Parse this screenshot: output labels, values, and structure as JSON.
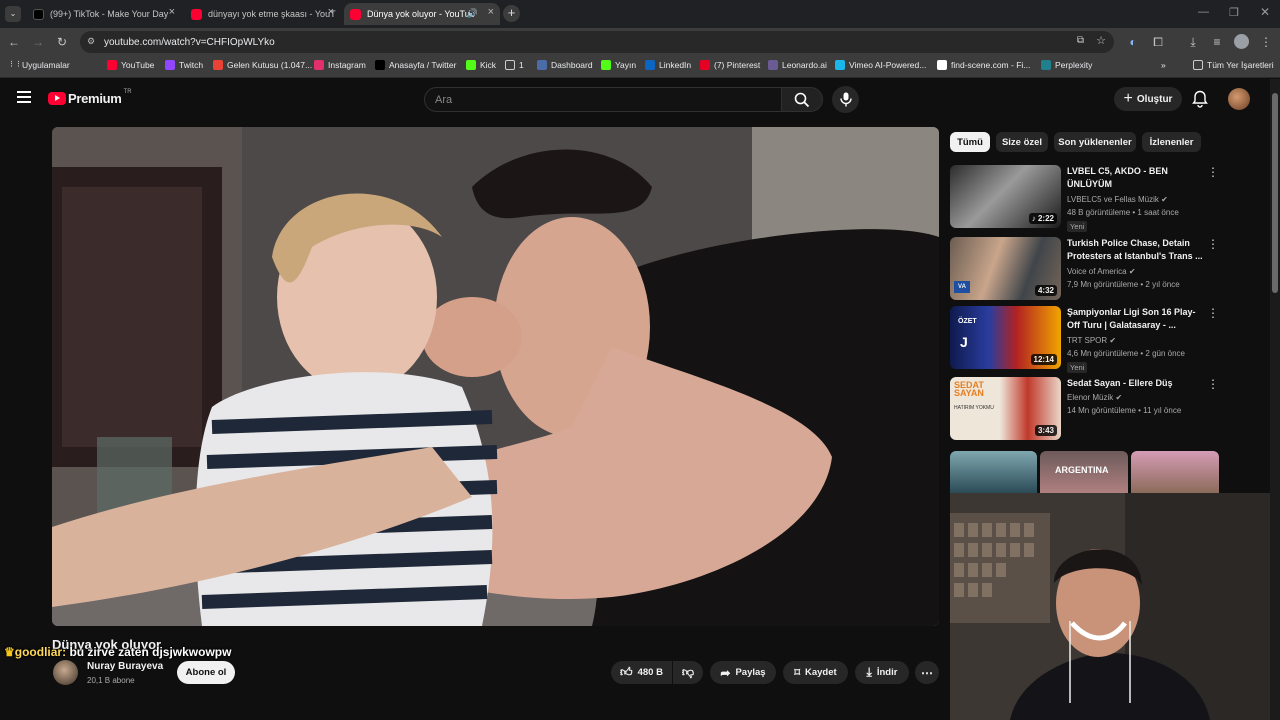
{
  "browser": {
    "tabs": [
      {
        "title": "(99+) TikTok - Make Your Day",
        "fav_color": "#000000"
      },
      {
        "title": "dünyayı yok etme şkaası - YouT",
        "fav_color": "#ff0033"
      },
      {
        "title": "Dünya yok oluyor - YouTub",
        "fav_color": "#ff0033"
      }
    ],
    "url": "youtube.com/watch?v=CHFIOpWLYko",
    "bookmarks": [
      {
        "label": "Uygulamalar",
        "icon": "grid-icon"
      },
      {
        "label": "YouTube",
        "icon": "youtube-icon",
        "color": "#ff0033"
      },
      {
        "label": "Twitch",
        "icon": "twitch-icon",
        "color": "#9146ff"
      },
      {
        "label": "Gelen Kutusu (1.047...",
        "icon": "gmail-icon",
        "color": "#ea4335"
      },
      {
        "label": "Instagram",
        "icon": "instagram-icon",
        "color": "#e1306c"
      },
      {
        "label": "Anasayfa / Twitter",
        "icon": "x-icon",
        "color": "#000000"
      },
      {
        "label": "Kick",
        "icon": "kick-icon",
        "color": "#53fc18"
      },
      {
        "label": "1",
        "icon": "folder-icon"
      },
      {
        "label": "Dashboard",
        "icon": "globe-icon",
        "color": "#4a6da7"
      },
      {
        "label": "Yayın",
        "icon": "kick-icon",
        "color": "#53fc18"
      },
      {
        "label": "LinkedIn",
        "icon": "linkedin-icon",
        "color": "#0a66c2"
      },
      {
        "label": "(7) Pinterest",
        "icon": "pinterest-icon",
        "color": "#e60023"
      },
      {
        "label": "Leonardo.ai",
        "icon": "leonardo-icon",
        "color": "#6b5b95"
      },
      {
        "label": "Vimeo AI-Powered...",
        "icon": "vimeo-icon",
        "color": "#1ab7ea"
      },
      {
        "label": "find-scene.com - Fi...",
        "icon": "scene-icon",
        "color": "#ffffff"
      },
      {
        "label": "Perplexity",
        "icon": "perplexity-icon",
        "color": "#20808d"
      }
    ],
    "all_bookmarks": "Tüm Yer İşaretleri"
  },
  "youtube": {
    "logo": "Premium",
    "region": "TR",
    "search_placeholder": "Ara",
    "create_label": "Oluştur"
  },
  "chips": [
    "Tümü",
    "Size özel",
    "Son yüklenenler",
    "İzlenenler"
  ],
  "recommendations": [
    {
      "title": "LVBEL C5, AKDO - BEN ÜNLÜYÜM",
      "channel": "LVBELC5 ve Fellas Müzik",
      "meta": "48 B görüntüleme • 1 saat önce",
      "badge": "Yeni",
      "duration": "2:22"
    },
    {
      "title": "Turkish Police Chase, Detain Protesters at Istanbul's Trans ...",
      "channel": "Voice of America",
      "meta": "7,9 Mn görüntüleme • 2 yıl önce",
      "badge": "",
      "duration": "4:32"
    },
    {
      "title": "Şampiyonlar Ligi Son 16 Play-Off Turu | Galatasaray - ...",
      "channel": "TRT SPOR",
      "meta": "4,6 Mn görüntüleme • 2 gün önce",
      "badge": "Yeni",
      "duration": "12:14"
    },
    {
      "title": "Sedat Sayan - Ellere Düş",
      "channel": "Elenor Müzik",
      "meta": "14 Mn görüntüleme • 11 yıl önce",
      "badge": "",
      "duration": "3:43"
    }
  ],
  "thumb_texts": {
    "argentina": "ARGENTINA",
    "ozet": "ÖZET",
    "sedat": "SEDAT SAYAN",
    "hatirim": "HATIRIM YOKMU"
  },
  "video": {
    "title": "Dünya yok oluyor",
    "channel": "Nuray Burayeva",
    "subscribers": "20,1 B abone",
    "subscribe_label": "Abone ol",
    "likes": "480 B",
    "share_label": "Paylaş",
    "save_label": "Kaydet",
    "download_label": "İndir"
  },
  "chat_overlay": {
    "user": "goodliar:",
    "message": "bu zirve zaten djsjwkwowpw"
  }
}
